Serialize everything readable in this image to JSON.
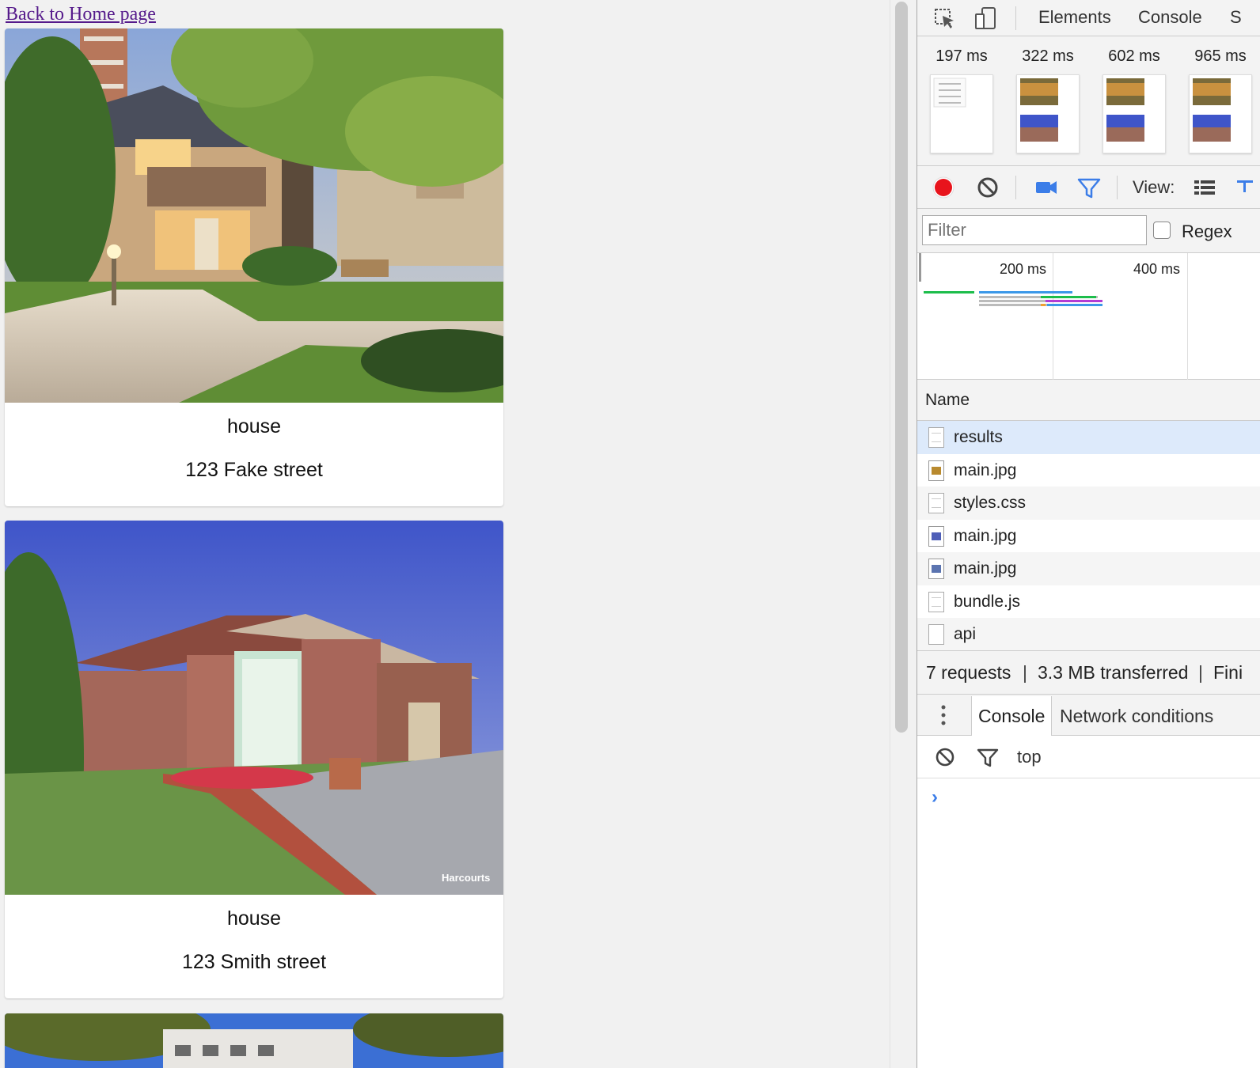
{
  "page": {
    "back_link": "Back to Home page",
    "listings": [
      {
        "title": "house",
        "address": "123 Fake street"
      },
      {
        "title": "house",
        "address": "123 Smith street"
      }
    ],
    "watermark": "Harcourts"
  },
  "devtools": {
    "tabs": [
      "Elements",
      "Console",
      "S"
    ],
    "filmstrip": [
      "197 ms",
      "322 ms",
      "602 ms",
      "965 ms"
    ],
    "toolbar": {
      "view_label": "View:"
    },
    "filter": {
      "placeholder": "Filter",
      "regex_label": "Regex"
    },
    "overview_ticks": [
      "200 ms",
      "400 ms"
    ],
    "name_header": "Name",
    "requests": [
      "results",
      "main.jpg",
      "styles.css",
      "main.jpg",
      "main.jpg",
      "bundle.js",
      "api"
    ],
    "status": {
      "requests": "7 requests",
      "transferred": "3.3 MB transferred",
      "finish": "Fini"
    },
    "drawer_tabs": [
      "Console",
      "Network conditions"
    ],
    "console": {
      "context": "top",
      "prompt": "›"
    },
    "colors": {
      "record": "#e8141c",
      "accent": "#3b7de8",
      "selected_row": "#ddeafb"
    }
  }
}
